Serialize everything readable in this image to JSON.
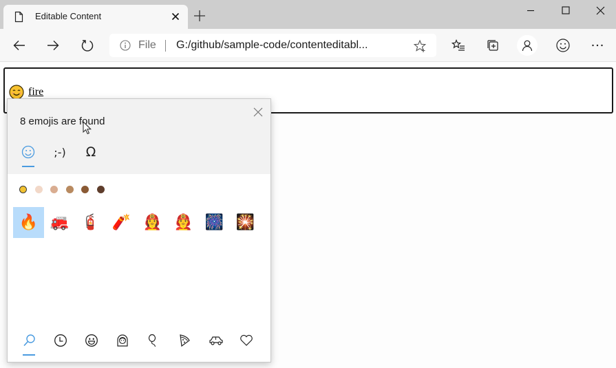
{
  "window": {
    "tab_title": "Editable Content",
    "tab_icon": "page-icon",
    "controls": [
      "minimize-icon",
      "maximize-icon",
      "close-icon"
    ]
  },
  "toolbar": {
    "address": {
      "security_label": "File",
      "url": "G:/github/sample-code/contenteditabl..."
    },
    "buttons": [
      "back-icon",
      "forward-icon",
      "refresh-icon",
      "favorites-icon",
      "collections-icon",
      "profile-icon",
      "feedback-smiley-icon",
      "more-icon"
    ]
  },
  "page": {
    "editable_content": {
      "emoji": "😊",
      "text": "fire"
    }
  },
  "emoji_panel": {
    "status": "8 emojis are found",
    "tabs": [
      {
        "name": "emoji",
        "label": "☺",
        "active": true
      },
      {
        "name": "kaomoji",
        "label": ";-)"
      },
      {
        "name": "symbols",
        "label": "Ω"
      }
    ],
    "skin_tones": [
      {
        "name": "default",
        "color": "#f2c230",
        "selected": true
      },
      {
        "name": "light",
        "color": "#f2d8c8"
      },
      {
        "name": "medium-light",
        "color": "#d9ad91"
      },
      {
        "name": "medium",
        "color": "#b88a60"
      },
      {
        "name": "medium-dark",
        "color": "#8a5a35"
      },
      {
        "name": "dark",
        "color": "#5e3d2c"
      }
    ],
    "results": [
      {
        "emoji": "🔥",
        "name": "fire",
        "selected": true
      },
      {
        "emoji": "🚒",
        "name": "fire engine"
      },
      {
        "emoji": "🧯",
        "name": "fire extinguisher"
      },
      {
        "emoji": "🧨",
        "name": "firecracker"
      },
      {
        "emoji": "👩‍🚒",
        "name": "woman firefighter"
      },
      {
        "emoji": "👨‍🚒",
        "name": "man firefighter"
      },
      {
        "emoji": "🎆",
        "name": "fireworks"
      },
      {
        "emoji": "🎇",
        "name": "sparkler"
      }
    ],
    "categories": [
      {
        "name": "search",
        "active": true
      },
      {
        "name": "recently-used"
      },
      {
        "name": "smiley-faces"
      },
      {
        "name": "people"
      },
      {
        "name": "celebrations"
      },
      {
        "name": "food"
      },
      {
        "name": "transport"
      },
      {
        "name": "symbols-heart"
      }
    ],
    "accent_color": "#4a9be0",
    "selection_color": "#b8dcfb"
  }
}
